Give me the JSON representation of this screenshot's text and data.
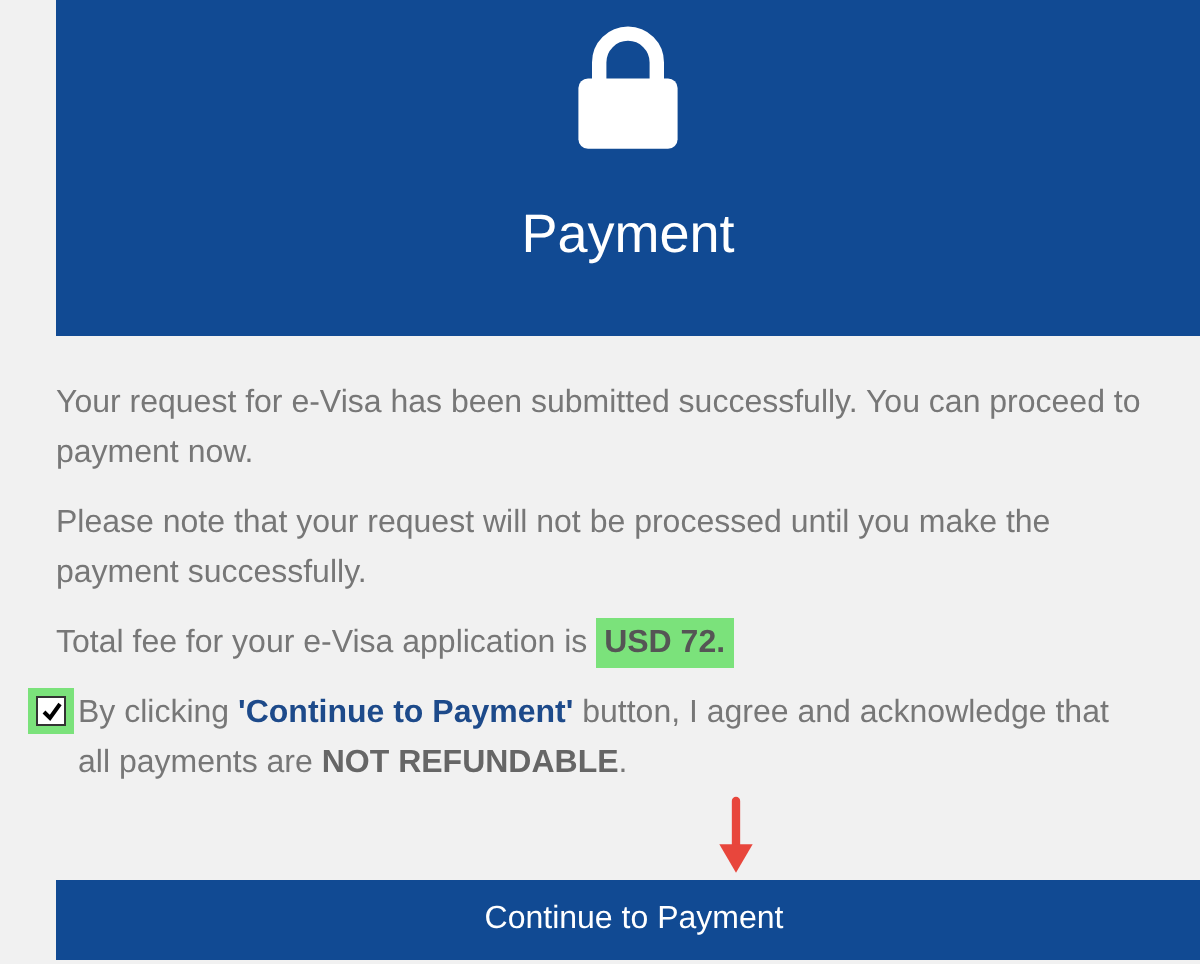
{
  "header": {
    "title": "Payment"
  },
  "messages": [
    "Your request for e-Visa has been submitted successfully. You can proceed to payment now.",
    "Please note that your request will not be processed until you make the payment successfully."
  ],
  "fee": {
    "text": "Total fee for your e-Visa application is **USD 72.**",
    "highlighted": true
  },
  "agreement": {
    "text": "By clicking **'Continue to Payment'** button, I agree and acknowledge that all payments are **NOT REFUNDABLE**.",
    "checked": true,
    "highlighted": true
  },
  "button": {
    "label": "Continue to Payment"
  }
}
